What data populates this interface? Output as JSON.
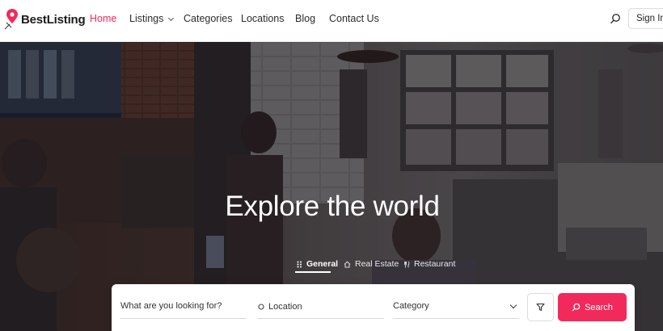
{
  "brand": {
    "name": "BestListing",
    "accent": "#f2295b"
  },
  "nav": {
    "items": [
      {
        "label": "Home",
        "active": true
      },
      {
        "label": "Listings",
        "dropdown": true
      },
      {
        "label": "Categories"
      },
      {
        "label": "Locations"
      },
      {
        "label": "Blog"
      },
      {
        "label": "Contact Us"
      }
    ],
    "search_icon": "search-icon",
    "signin_label": "Sign In"
  },
  "hero": {
    "headline": "Explore the world",
    "tabs": [
      {
        "label": "General",
        "icon": "grid-dots-icon",
        "active": true
      },
      {
        "label": "Real Estate",
        "icon": "home-icon"
      },
      {
        "label": "Restaurant",
        "icon": "utensils-icon"
      }
    ]
  },
  "search": {
    "what_placeholder": "What are you looking for?",
    "location_placeholder": "Location",
    "location_icon": "location-pin-icon",
    "category_label": "Category",
    "filter_icon": "filter-icon",
    "button_label": "Search"
  }
}
